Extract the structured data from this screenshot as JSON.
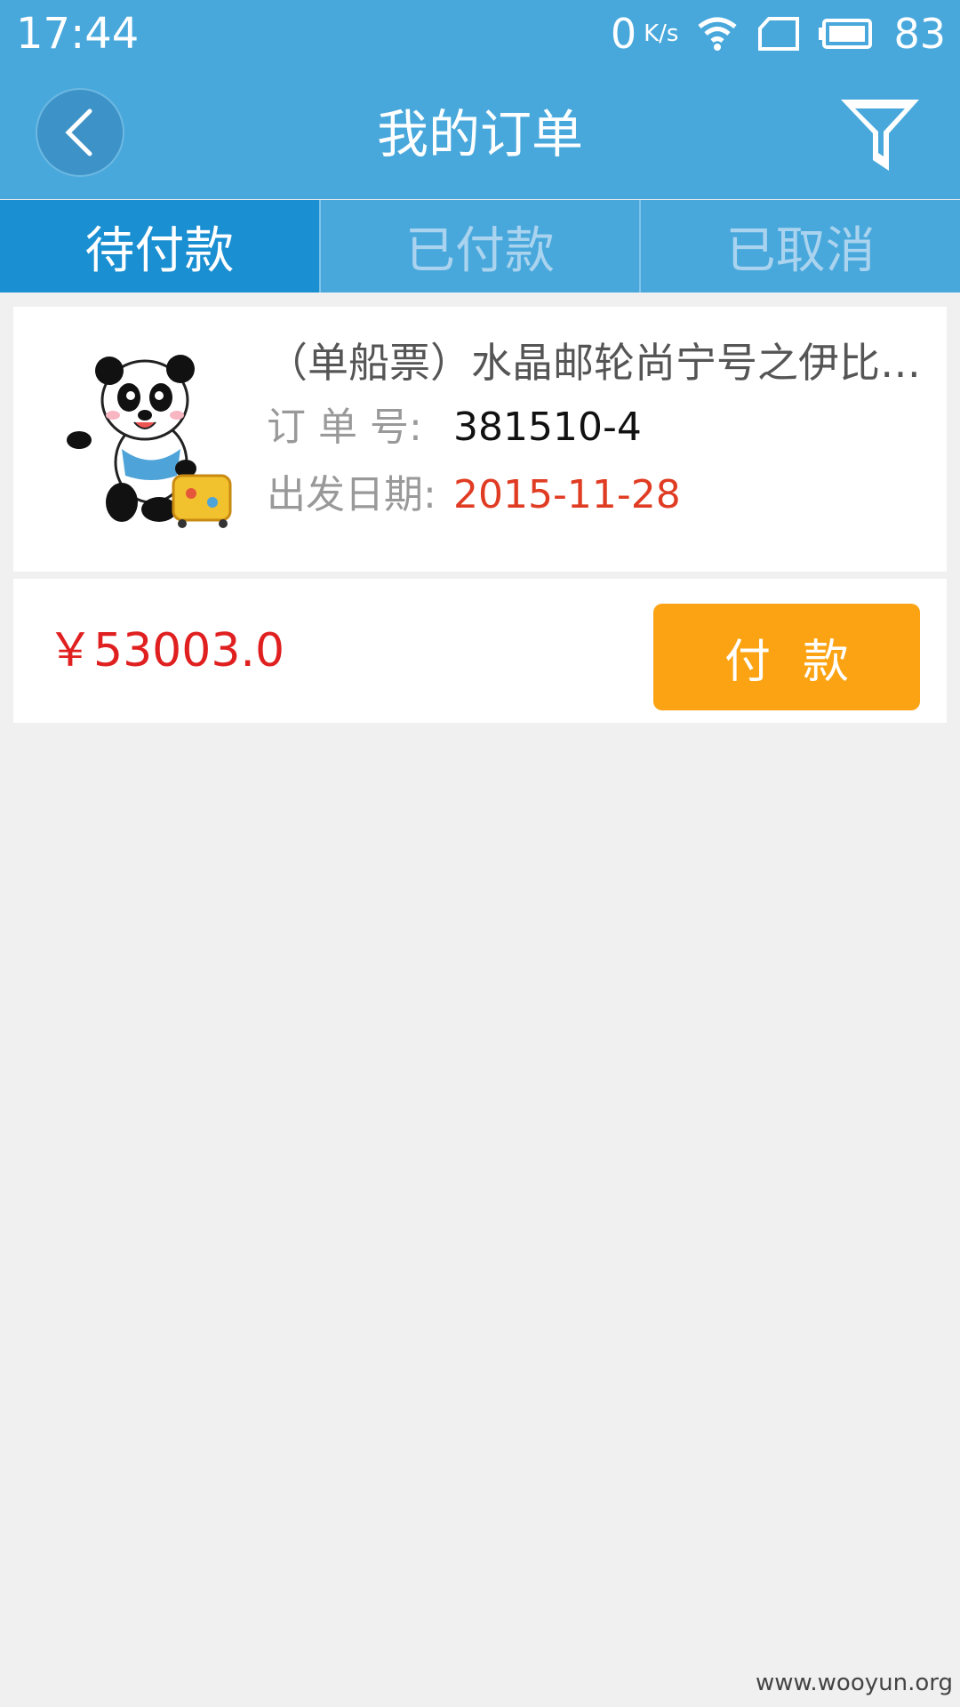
{
  "status_bar": {
    "time": "17:44",
    "net_speed_value": "0",
    "net_speed_unit": "K/s",
    "battery_level": "83"
  },
  "header": {
    "title": "我的订单",
    "back_icon": "chevron-left-icon",
    "filter_icon": "filter-icon"
  },
  "tabs": [
    {
      "label": "待付款",
      "active": true
    },
    {
      "label": "已付款",
      "active": false
    },
    {
      "label": "已取消",
      "active": false
    }
  ],
  "order": {
    "title": "（单船票）水晶邮轮尚宁号之伊比利亚半岛",
    "order_no_label": "订  单  号:",
    "order_no": "381510-4",
    "date_label": "出发日期:",
    "date": "2015-11-28",
    "price": "￥53003.0",
    "pay_label": "付款"
  },
  "watermark": "www.wooyun.org",
  "colors": {
    "header_bg": "#48a8dc",
    "active_tab_bg": "#1a8fd2",
    "pay_button": "#fba312",
    "price_red": "#e02020",
    "date_red": "#e03c23"
  }
}
